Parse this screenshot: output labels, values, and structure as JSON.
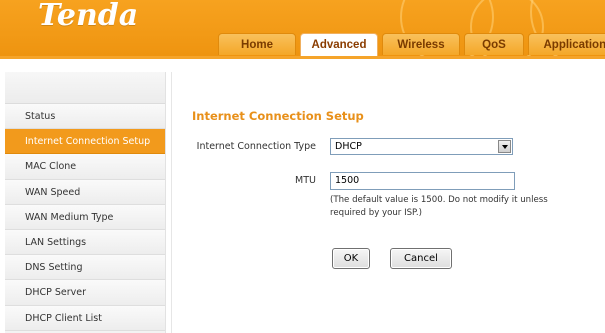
{
  "brand": {
    "logo_text": "Tenda"
  },
  "tabs": [
    {
      "label": "Home"
    },
    {
      "label": "Advanced"
    },
    {
      "label": "Wireless"
    },
    {
      "label": "QoS"
    },
    {
      "label": "Applications"
    }
  ],
  "active_tab": "Advanced",
  "sidebar": {
    "items": [
      {
        "label": "Status"
      },
      {
        "label": "Internet Connection Setup"
      },
      {
        "label": "MAC Clone"
      },
      {
        "label": "WAN Speed"
      },
      {
        "label": "WAN Medium Type"
      },
      {
        "label": "LAN Settings"
      },
      {
        "label": "DNS Setting"
      },
      {
        "label": "DHCP Server"
      },
      {
        "label": "DHCP Client List"
      }
    ],
    "active_item": "Internet Connection Setup"
  },
  "main": {
    "title": "Internet Connection Setup",
    "connection_type_label": "Internet Connection Type",
    "connection_type_value": "DHCP",
    "mtu_label": "MTU",
    "mtu_value": "1500",
    "mtu_hint": "(The default value is 1500. Do not modify it unless required by your ISP.)",
    "ok_label": "OK",
    "cancel_label": "Cancel"
  },
  "colors": {
    "accent": "#f29a1c",
    "title": "#e8901a"
  }
}
